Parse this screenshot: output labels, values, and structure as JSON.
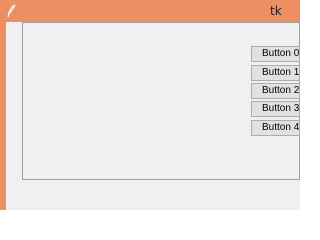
{
  "window": {
    "title": "tk",
    "icon": "feather-icon",
    "accent_color": "#ee8e63",
    "background_color": "#f0f0f0"
  },
  "buttons": [
    {
      "label": "Button 0"
    },
    {
      "label": "Button 1"
    },
    {
      "label": "Button 2"
    },
    {
      "label": "Button 3"
    },
    {
      "label": "Button 4"
    }
  ]
}
